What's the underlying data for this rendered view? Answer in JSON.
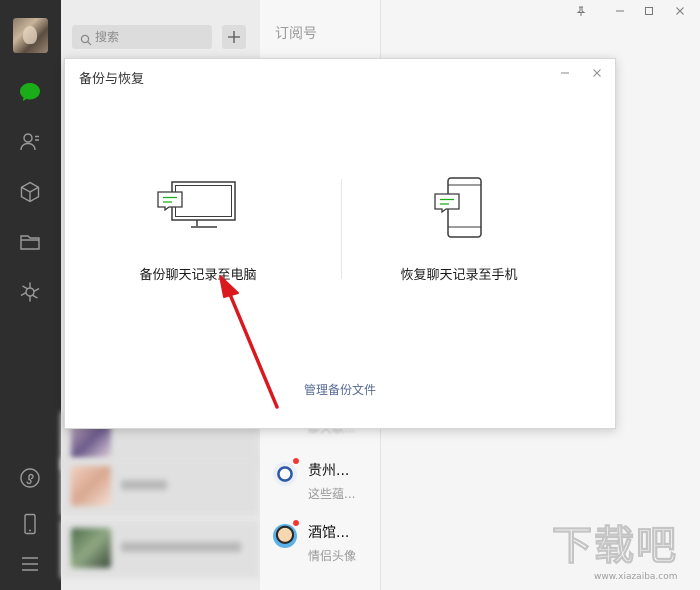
{
  "sidebar": {
    "icons": [
      "chat-icon",
      "contacts-icon",
      "collections-icon",
      "files-icon",
      "moments-icon",
      "miniprogram-icon",
      "phone-icon",
      "menu-icon"
    ],
    "accent_color": "#1aad19"
  },
  "list": {
    "search_placeholder": "搜索"
  },
  "chat_column": {
    "header": "订阅号",
    "faded_sub": "那天歌...",
    "items": [
      {
        "name": "贵州...",
        "sub": "这些蕴..."
      },
      {
        "name": "酒馆...",
        "sub": "情侣头像"
      }
    ],
    "badge_color": "#f43530"
  },
  "dialog": {
    "title": "备份与恢复",
    "options": [
      {
        "label": "备份聊天记录至电脑"
      },
      {
        "label": "恢复聊天记录至手机"
      }
    ],
    "manage_link": "管理备份文件",
    "link_color": "#576b95"
  },
  "watermark": {
    "text": "下载吧",
    "url": "www.xiazaiba.com"
  }
}
